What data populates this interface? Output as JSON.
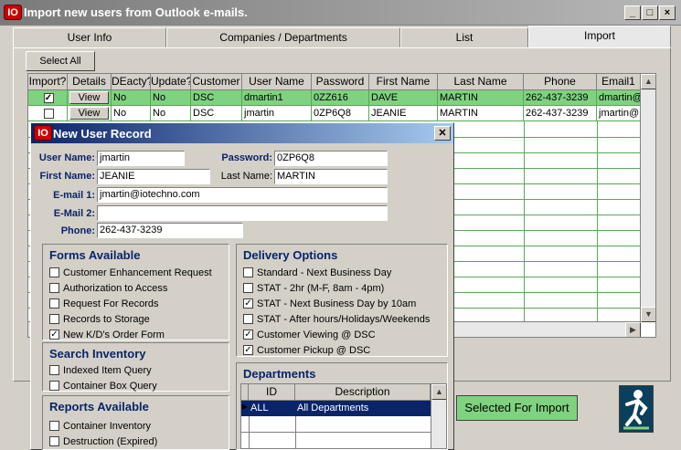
{
  "window": {
    "title": "Import new users from Outlook e-mails.",
    "icon_text": "IO",
    "controls": [
      "_",
      "□",
      "×"
    ]
  },
  "tabs": [
    {
      "label": "User Info"
    },
    {
      "label": "Companies / Departments"
    },
    {
      "label": "List"
    },
    {
      "label": "Import"
    }
  ],
  "select_all_label": "Select All",
  "grid": {
    "headers": [
      "Import?",
      "Details",
      "DEacty?",
      "Update?",
      "Customer",
      "User Name",
      "Password",
      "First Name",
      "Last Name",
      "Phone",
      "Email1"
    ],
    "rows": [
      {
        "import": true,
        "details": "View",
        "deacty": "No",
        "update": "No",
        "customer": "DSC",
        "username": "dmartin1",
        "password": "0ZZ616",
        "first": "DAVE",
        "last": "MARTIN",
        "phone": "262-437-3239",
        "email": "dmartin@"
      },
      {
        "import": false,
        "details": "View",
        "deacty": "No",
        "update": "No",
        "customer": "DSC",
        "username": "jmartin",
        "password": "0ZP6Q8",
        "first": "JEANIE",
        "last": "MARTIN",
        "phone": "262-437-3239",
        "email": "jmartin@"
      }
    ]
  },
  "selected_for_import_label": "Selected For Import",
  "dialog": {
    "title": "New User Record",
    "icon_text": "IO",
    "user_name_label": "User Name:",
    "user_name": "jmartin",
    "password_label": "Password:",
    "password": "0ZP6Q8",
    "first_name_label": "First Name:",
    "first_name": "JEANIE",
    "last_name_label": "Last Name:",
    "last_name": "MARTIN",
    "email1_label": "E-mail 1:",
    "email1": "jmartin@iotechno.com",
    "email2_label": "E-Mail 2:",
    "email2": "",
    "phone_label": "Phone:",
    "phone": "262-437-3239",
    "forms": {
      "title": "Forms Available",
      "items": [
        {
          "label": "Customer Enhancement Request",
          "checked": false
        },
        {
          "label": "Authorization to Access",
          "checked": false
        },
        {
          "label": "Request For Records",
          "checked": false
        },
        {
          "label": "Records to Storage",
          "checked": false
        },
        {
          "label": "New K/D's Order Form",
          "checked": true
        }
      ]
    },
    "search": {
      "title": "Search Inventory",
      "items": [
        {
          "label": "Indexed Item Query",
          "checked": false
        },
        {
          "label": "Container Box Query",
          "checked": false
        }
      ]
    },
    "reports": {
      "title": "Reports Available",
      "items": [
        {
          "label": "Container Inventory",
          "checked": false
        },
        {
          "label": "Destruction (Expired)",
          "checked": false
        }
      ]
    },
    "delivery": {
      "title": "Delivery Options",
      "items": [
        {
          "label": "Standard - Next Business Day",
          "checked": false
        },
        {
          "label": "STAT - 2hr (M-F, 8am - 4pm)",
          "checked": false
        },
        {
          "label": "STAT - Next Business Day by 10am",
          "checked": true
        },
        {
          "label": "STAT - After hours/Holidays/Weekends",
          "checked": false
        },
        {
          "label": "Customer Viewing @ DSC",
          "checked": true
        },
        {
          "label": "Customer Pickup @ DSC",
          "checked": true
        }
      ]
    },
    "departments": {
      "title": "Departments",
      "headers": [
        "ID",
        "Description"
      ],
      "rows": [
        {
          "id": "ALL",
          "description": "All Departments"
        }
      ]
    }
  }
}
